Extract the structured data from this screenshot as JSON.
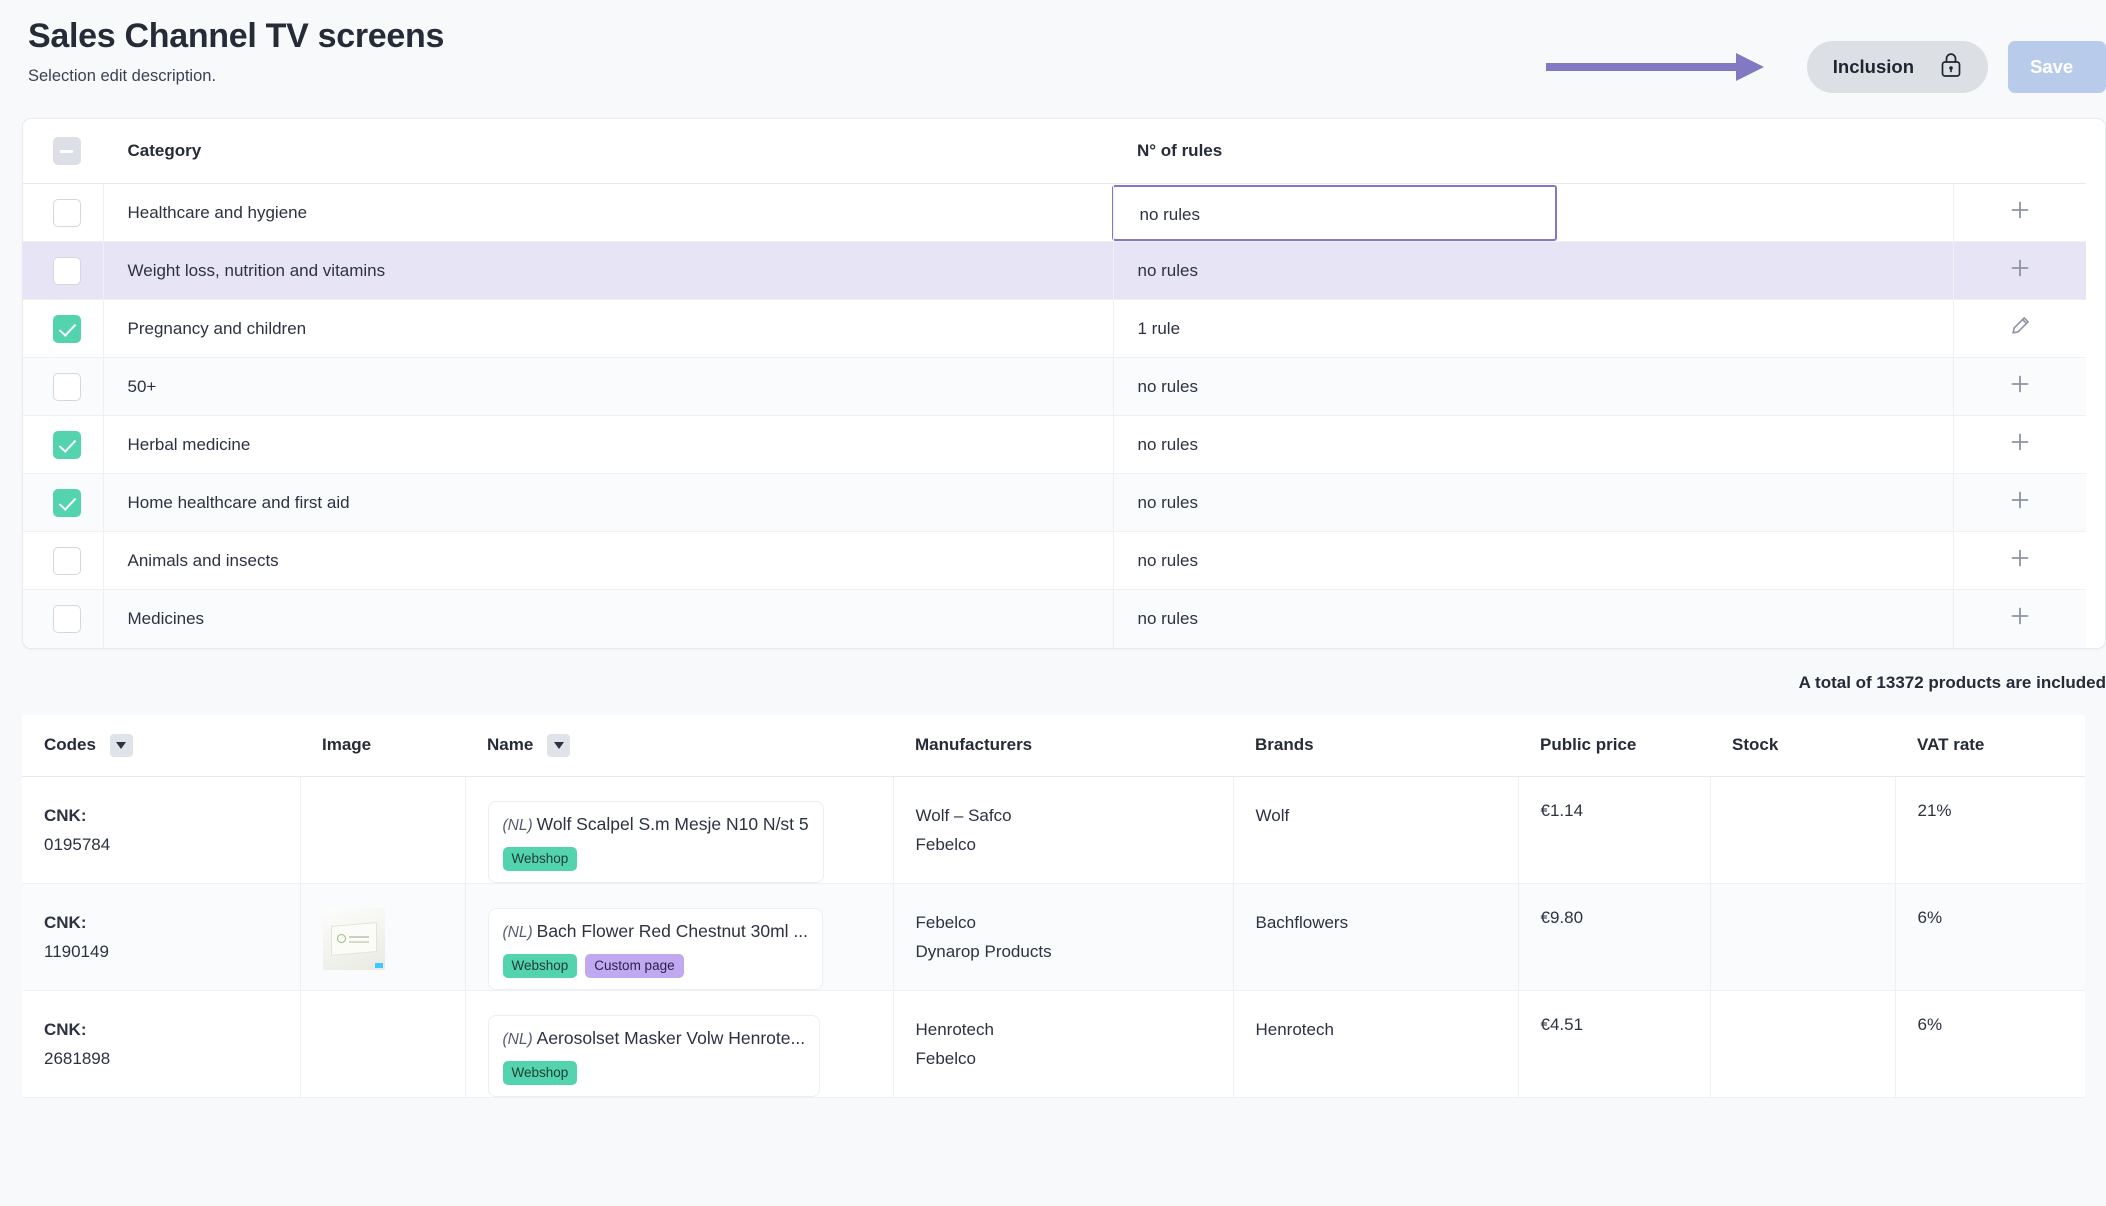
{
  "header": {
    "title": "Sales Channel TV screens",
    "subtitle": "Selection edit description.",
    "inclusion_label": "Inclusion",
    "inclusion_icon": "lock-icon",
    "save_label": "Save",
    "arrow_color": "#8279c4",
    "save_color": "#b8cbea"
  },
  "category_table": {
    "columns": {
      "select": "",
      "category": "Category",
      "rules": "N° of rules"
    },
    "header_checkbox_state": "indeterminate",
    "rows": [
      {
        "checked": false,
        "category": "Healthcare and hygiene",
        "rules": "no rules",
        "action": "plus-icon",
        "row_state": "focused"
      },
      {
        "checked": false,
        "category": "Weight loss, nutrition and vitamins",
        "rules": "no rules",
        "action": "plus-icon",
        "row_state": "hovered"
      },
      {
        "checked": true,
        "category": "Pregnancy and children",
        "rules": "1 rule",
        "action": "pencil-icon",
        "row_state": "plain"
      },
      {
        "checked": false,
        "category": "50+",
        "rules": "no rules",
        "action": "plus-icon",
        "row_state": "stripe"
      },
      {
        "checked": true,
        "category": "Herbal medicine",
        "rules": "no rules",
        "action": "plus-icon",
        "row_state": "plain"
      },
      {
        "checked": true,
        "category": "Home healthcare and first aid",
        "rules": "no rules",
        "action": "plus-icon",
        "row_state": "stripe"
      },
      {
        "checked": false,
        "category": "Animals and insects",
        "rules": "no rules",
        "action": "plus-icon",
        "row_state": "plain"
      },
      {
        "checked": false,
        "category": "Medicines",
        "rules": "no rules",
        "action": "plus-icon",
        "row_state": "stripe"
      }
    ]
  },
  "total_text": "A total of 13372 products are included",
  "products_table": {
    "columns": {
      "codes": "Codes",
      "image": "Image",
      "name": "Name",
      "manufacturers": "Manufacturers",
      "brands": "Brands",
      "public_price": "Public price",
      "stock": "Stock",
      "vat_rate": "VAT rate"
    },
    "rows": [
      {
        "code_label": "CNK:",
        "code_value": "0195784",
        "has_image": false,
        "lang": "(NL)",
        "name": "Wolf Scalpel S.m Mesje N10 N/st 5",
        "badges": [
          "Webshop"
        ],
        "manufacturers": [
          "Wolf – Safco",
          "Febelco"
        ],
        "brands": [
          "Wolf"
        ],
        "public_price": "€1.14",
        "stock": "",
        "vat_rate": "21%"
      },
      {
        "code_label": "CNK:",
        "code_value": "1190149",
        "has_image": true,
        "lang": "(NL)",
        "name": "Bach Flower Red Chestnut 30ml ...",
        "badges": [
          "Webshop",
          "Custom page"
        ],
        "manufacturers": [
          "Febelco",
          "Dynarop Products"
        ],
        "brands": [
          "Bachflowers"
        ],
        "public_price": "€9.80",
        "stock": "",
        "vat_rate": "6%"
      },
      {
        "code_label": "CNK:",
        "code_value": "2681898",
        "has_image": false,
        "lang": "(NL)",
        "name": "Aerosolset Masker Volw Henrote...",
        "badges": [
          "Webshop"
        ],
        "manufacturers": [
          "Henrotech",
          "Febelco"
        ],
        "brands": [
          "Henrotech"
        ],
        "public_price": "€4.51",
        "stock": "",
        "vat_rate": "6%"
      }
    ]
  }
}
